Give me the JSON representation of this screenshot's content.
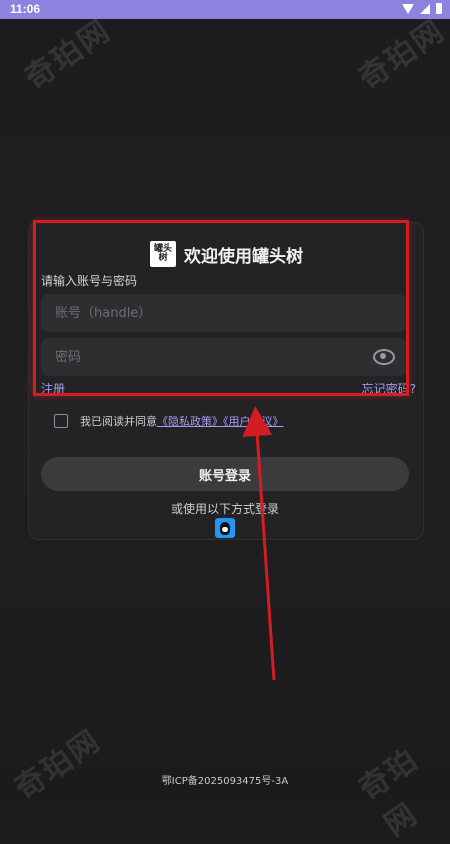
{
  "status_bar": {
    "time": "11:06"
  },
  "watermark_text": "奇珀网",
  "header": {
    "logo_text": "罐头\n树",
    "title": "欢迎使用罐头树"
  },
  "form": {
    "prompt": "请输入账号与密码",
    "username_placeholder": "账号（handle）",
    "password_placeholder": "密码",
    "register_label": "注册",
    "forgot_label": "忘记密码?"
  },
  "agreement": {
    "prefix": "我已阅读并同意",
    "privacy_link": "《隐私政策》",
    "user_link": "《用户协议》"
  },
  "login_button": "账号登录",
  "alt_login_text": "或使用以下方式登录",
  "footer": "鄂ICP备2025093475号-3A",
  "colors": {
    "accent": "#a89cf2",
    "status_bar": "#8c83e0",
    "highlight": "#d21d22"
  }
}
